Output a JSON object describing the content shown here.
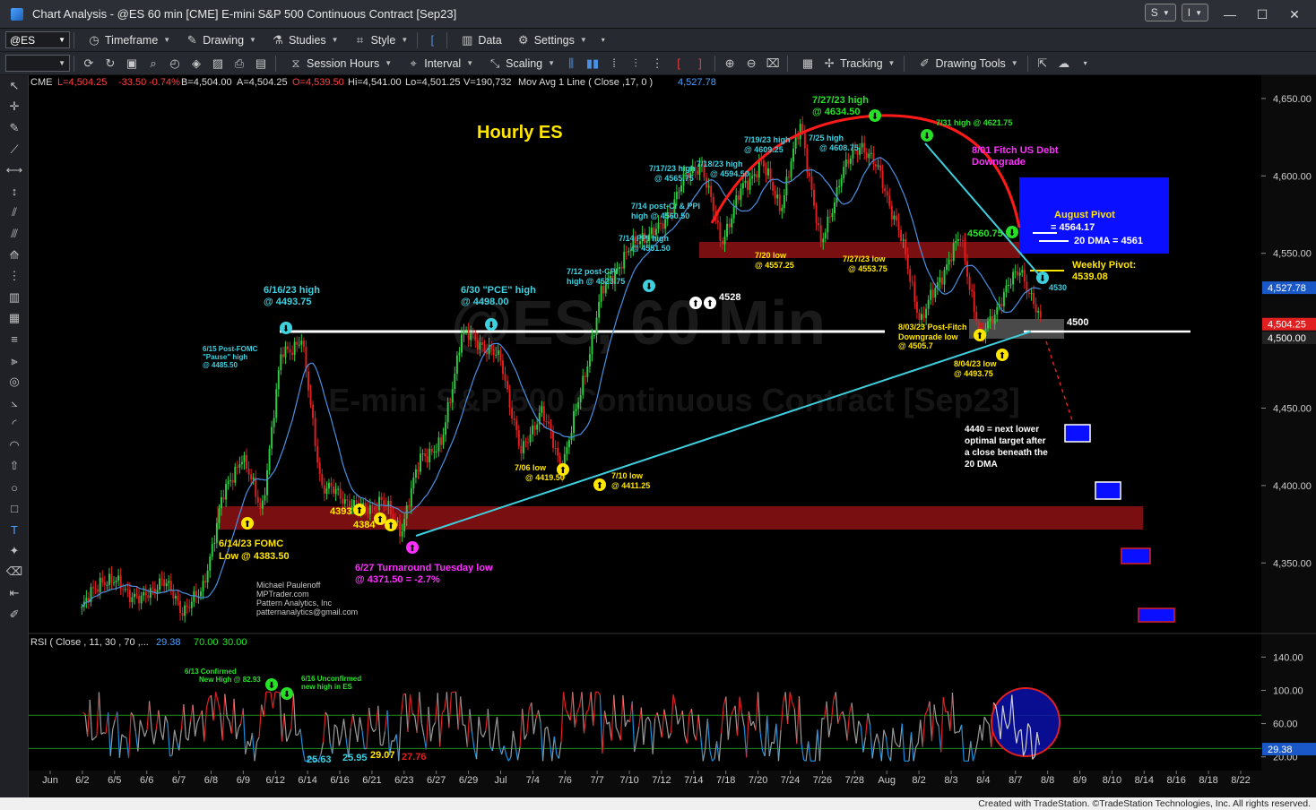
{
  "window": {
    "title": "Chart Analysis - @ES 60 min [CME] E-mini S&P 500 Continuous Contract [Sep23]",
    "s_button": "S",
    "i_button": "I"
  },
  "toolbar1": {
    "symbol": "@ES",
    "timeframe": "Timeframe",
    "drawing": "Drawing",
    "studies": "Studies",
    "style": "Style",
    "data": "Data",
    "settings": "Settings"
  },
  "toolbar2": {
    "session_hours": "Session Hours",
    "interval": "Interval",
    "scaling": "Scaling",
    "tracking": "Tracking",
    "drawing_tools": "Drawing Tools"
  },
  "status_bar": {
    "created_with": "Created with TradeStation. ©TradeStation Technologies, Inc. All rights reserved."
  },
  "colors": {
    "background": "#000000",
    "candle_green": "#2ecc40",
    "candle_red": "#e02020",
    "ma_line": "#4a90e2",
    "annotation_cyan": "#3fd0e0",
    "annotation_yellow": "#ffe600",
    "annotation_green": "#28e028",
    "annotation_magenta": "#ff30ff",
    "support_band": "#7a0f12",
    "pivot_box": "#0a10ff"
  },
  "chart_data": [
    {
      "type": "candlestick",
      "title": "Hourly ES",
      "watermark": "@ES, 60 Min",
      "watermark_sub": "E-mini S&P 500 Continuous Contract [Sep23]",
      "header": {
        "exchange": "CME",
        "last": "L=4,504.25",
        "change": "-33.50",
        "change_pct": "-0.74%",
        "bid": "B=4,504.00",
        "ask": "A=4,504.25",
        "open": "O=4,539.50",
        "high": "Hi=4,541.00",
        "low": "Lo=4,501.25",
        "volume": "V=190,732",
        "study": "Mov Avg 1 Line ( Close ,17, 0 )",
        "study_value": "4,527.78"
      },
      "x_tick_labels": [
        "Jun",
        "6/2",
        "6/5",
        "6/6",
        "6/7",
        "6/8",
        "6/9",
        "6/12",
        "6/14",
        "6/16",
        "6/21",
        "6/23",
        "6/27",
        "6/29",
        "Jul",
        "7/4",
        "7/6",
        "7/7",
        "7/10",
        "7/12",
        "7/14",
        "7/18",
        "7/20",
        "7/24",
        "7/26",
        "7/28",
        "Aug",
        "8/2",
        "8/3",
        "8/4",
        "8/7",
        "8/8",
        "8/9",
        "8/10",
        "8/14",
        "8/16",
        "8/18",
        "8/22"
      ],
      "y_tick_labels": [
        "4,650.00",
        "4,600.00",
        "4,550.00",
        "4,450.00",
        "4,400.00",
        "4,350.00"
      ],
      "ylim": [
        4305,
        4665
      ],
      "price_tags": [
        {
          "label": "4,527.78",
          "value": 4527.78
        },
        {
          "label": "4,504.25",
          "value": 4504.25
        },
        {
          "label": "4,500.00",
          "value": 4500.0
        }
      ],
      "key_points": [
        {
          "x": "6/01",
          "value": 4320
        },
        {
          "x": "6/02",
          "value": 4340
        },
        {
          "x": "6/05",
          "value": 4335
        },
        {
          "x": "6/06",
          "value": 4325
        },
        {
          "x": "6/07",
          "value": 4340
        },
        {
          "x": "6/08",
          "value": 4320
        },
        {
          "x": "6/09",
          "value": 4330
        },
        {
          "x": "6/12",
          "value": 4390
        },
        {
          "x": "6/13",
          "value": 4420
        },
        {
          "x": "6/14",
          "value": 4383.5
        },
        {
          "x": "6/15",
          "value": 4485.5
        },
        {
          "x": "6/16",
          "value": 4493.75
        },
        {
          "x": "6/21",
          "value": 4400
        },
        {
          "x": "6/22",
          "value": 4393
        },
        {
          "x": "6/23",
          "value": 4384
        },
        {
          "x": "6/26",
          "value": 4390
        },
        {
          "x": "6/27",
          "value": 4371.5
        },
        {
          "x": "6/28",
          "value": 4420
        },
        {
          "x": "6/29",
          "value": 4425
        },
        {
          "x": "6/30",
          "value": 4498
        },
        {
          "x": "7/03",
          "value": 4492
        },
        {
          "x": "7/05",
          "value": 4480
        },
        {
          "x": "7/06",
          "value": 4419.5
        },
        {
          "x": "7/07",
          "value": 4450
        },
        {
          "x": "7/10",
          "value": 4411.25
        },
        {
          "x": "7/11",
          "value": 4460
        },
        {
          "x": "7/12",
          "value": 4523.75
        },
        {
          "x": "7/13",
          "value": 4545
        },
        {
          "x": "7/14",
          "value": 4560.5
        },
        {
          "x": "7/17",
          "value": 4565.75
        },
        {
          "x": "7/18",
          "value": 4594.5
        },
        {
          "x": "7/19",
          "value": 4609.25
        },
        {
          "x": "7/20",
          "value": 4557.25
        },
        {
          "x": "7/24",
          "value": 4590
        },
        {
          "x": "7/25",
          "value": 4608.75
        },
        {
          "x": "7/26",
          "value": 4580
        },
        {
          "x": "7/27",
          "value": 4634.5
        },
        {
          "x": "7/27",
          "value": 4553.75
        },
        {
          "x": "7/28",
          "value": 4600
        },
        {
          "x": "7/31",
          "value": 4621.75
        },
        {
          "x": "8/01",
          "value": 4600
        },
        {
          "x": "8/02",
          "value": 4560
        },
        {
          "x": "8/03",
          "value": 4505.7
        },
        {
          "x": "8/03",
          "value": 4535
        },
        {
          "x": "8/04",
          "value": 4560.75
        },
        {
          "x": "8/04",
          "value": 4493.75
        },
        {
          "x": "8/07",
          "value": 4520
        },
        {
          "x": "8/08",
          "value": 4541
        },
        {
          "x": "8/08",
          "value": 4504.25
        }
      ],
      "series": [
        {
          "name": "Mov Avg 1 Line ( Close ,17, 0 )",
          "last": 4527.78
        }
      ],
      "annotations": [
        {
          "text": "6/16/23 high",
          "color": "cyan"
        },
        {
          "text": "@ 4493.75",
          "color": "cyan"
        },
        {
          "text": "6/15 Post-FOMC",
          "color": "cyan"
        },
        {
          "text": "\"Pause\" high",
          "color": "cyan"
        },
        {
          "text": "@ 4485.50",
          "color": "cyan"
        },
        {
          "text": "6/30 \"PCE\" high",
          "color": "cyan"
        },
        {
          "text": "@ 4498.00",
          "color": "cyan"
        },
        {
          "text": "7/12 post-CPI",
          "color": "cyan"
        },
        {
          "text": "high @ 4523.75",
          "color": "cyan"
        },
        {
          "text": "7/14 PPI high",
          "color": "cyan"
        },
        {
          "text": "@ 4551.50",
          "color": "cyan"
        },
        {
          "text": "7/14 post-Ci & PPI",
          "color": "cyan"
        },
        {
          "text": "high @ 4560.50",
          "color": "cyan"
        },
        {
          "text": "7/17/23 high",
          "color": "cyan"
        },
        {
          "text": "@ 4565.75",
          "color": "cyan"
        },
        {
          "text": "7/18/23 high",
          "color": "cyan"
        },
        {
          "text": "@ 4594.50",
          "color": "cyan"
        },
        {
          "text": "7/19/23 high",
          "color": "cyan"
        },
        {
          "text": "@ 4609.25",
          "color": "cyan"
        },
        {
          "text": "7/25 high",
          "color": "cyan"
        },
        {
          "text": "@ 4608.75",
          "color": "cyan"
        },
        {
          "text": "7/27/23 high",
          "color": "green"
        },
        {
          "text": "@ 4634.50",
          "color": "green"
        },
        {
          "text": "7/31 high @ 4621.75",
          "color": "green"
        },
        {
          "text": "8/01 Fitch US Debt",
          "color": "magenta"
        },
        {
          "text": "Downgrade",
          "color": "magenta"
        },
        {
          "text": "4528",
          "color": "white"
        },
        {
          "text": "7/20 low",
          "color": "yellow"
        },
        {
          "text": "@ 4557.25",
          "color": "yellow"
        },
        {
          "text": "7/27/23 low",
          "color": "yellow"
        },
        {
          "text": "@ 4553.75",
          "color": "yellow"
        },
        {
          "text": "4560.75",
          "color": "green"
        },
        {
          "text": "August Pivot",
          "color": "yellow"
        },
        {
          "text": "= 4564.17",
          "color": "white"
        },
        {
          "text": "20 DMA = 4561",
          "color": "white"
        },
        {
          "text": "Weekly Pivot:",
          "color": "yellow"
        },
        {
          "text": "4539.08",
          "color": "yellow"
        },
        {
          "text": "4530",
          "color": "cyan"
        },
        {
          "text": "4500",
          "color": "white"
        },
        {
          "text": "8/03/23 Post-Fitch",
          "color": "yellow"
        },
        {
          "text": "Downgrade low",
          "color": "yellow"
        },
        {
          "text": "@ 4505.7",
          "color": "yellow"
        },
        {
          "text": "8/04/23 low",
          "color": "yellow"
        },
        {
          "text": "@ 4493.75",
          "color": "yellow"
        },
        {
          "text": "4440 = next lower",
          "color": "white"
        },
        {
          "text": "optimal target after",
          "color": "white"
        },
        {
          "text": "a close beneath the",
          "color": "white"
        },
        {
          "text": "20 DMA",
          "color": "white"
        },
        {
          "text": "7/06 low",
          "color": "yellow"
        },
        {
          "text": "@ 4419.50",
          "color": "yellow"
        },
        {
          "text": "7/10 low",
          "color": "yellow"
        },
        {
          "text": "@ 4411.25",
          "color": "yellow"
        },
        {
          "text": "4393",
          "color": "yellow"
        },
        {
          "text": "4384",
          "color": "yellow"
        },
        {
          "text": "6/14/23 FOMC",
          "color": "yellow"
        },
        {
          "text": "Low @ 4383.50",
          "color": "yellow"
        },
        {
          "text": "6/27 Turnaround Tuesday low",
          "color": "magenta"
        },
        {
          "text": "@ 4371.50 = -2.7%",
          "color": "magenta"
        },
        {
          "text": "Michael Paulenoff",
          "color": "gray"
        },
        {
          "text": "MPTrader.com",
          "color": "gray"
        },
        {
          "text": "Pattern Analytics, Inc",
          "color": "gray"
        },
        {
          "text": "patternanalytics@gmail.com",
          "color": "gray"
        }
      ],
      "levels": [
        {
          "name": "white horizontal",
          "value": 4500
        },
        {
          "name": "red support band low",
          "value": 4373
        },
        {
          "name": "red support band high",
          "value": 4388
        },
        {
          "name": "red resistance band low",
          "value": 4550
        },
        {
          "name": "red resistance band high",
          "value": 4561
        }
      ]
    },
    {
      "type": "line",
      "title": "RSI ( Close , 11, 30 , 70 ,...",
      "header_values": [
        "29.38",
        "70.00",
        "30.00"
      ],
      "y_tick_labels": [
        "140.00",
        "100.00",
        "60.00",
        "20.00"
      ],
      "ylim": [
        10,
        150
      ],
      "current_label": "29.38",
      "overbought": 70,
      "oversold": 30,
      "annotations": [
        {
          "text": "6/13 Confirmed",
          "color": "green"
        },
        {
          "text": "New High @ 82.93",
          "color": "green"
        },
        {
          "text": "6/16 Unconfirmed",
          "color": "green"
        },
        {
          "text": "new high in ES",
          "color": "green"
        },
        {
          "text": "25.63",
          "color": "cyan"
        },
        {
          "text": "25.95",
          "color": "cyan"
        },
        {
          "text": "29.07",
          "color": "yellow"
        },
        {
          "text": "27.76",
          "color": "red"
        }
      ]
    }
  ]
}
